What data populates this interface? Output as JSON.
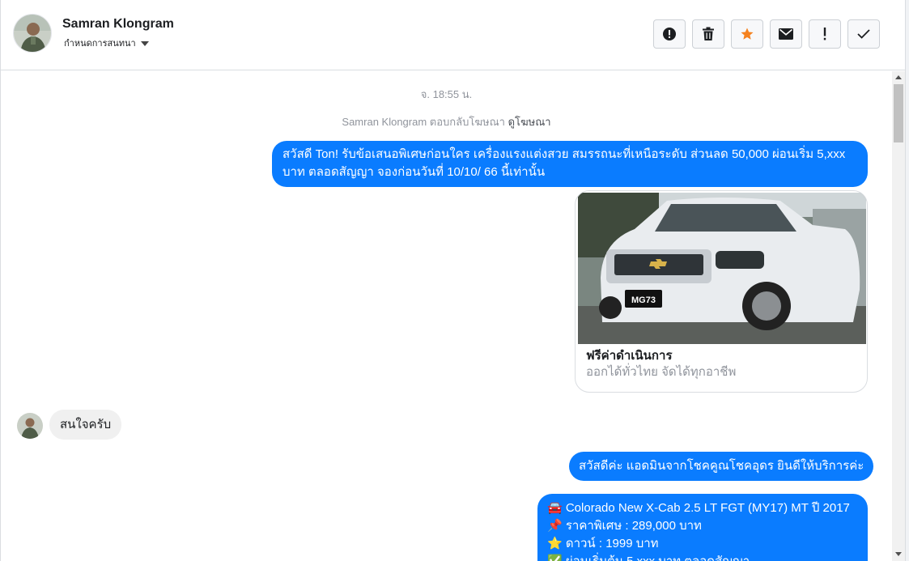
{
  "header": {
    "contact_name": "Samran Klongram",
    "subtitle": "กำหนดการสนทนา"
  },
  "toolbar": {
    "buttons": [
      {
        "icon": "alert-circle-icon"
      },
      {
        "icon": "trash-icon"
      },
      {
        "icon": "star-icon",
        "color": "#f5821f"
      },
      {
        "icon": "envelope-icon"
      },
      {
        "icon": "exclamation-icon"
      },
      {
        "icon": "check-icon"
      }
    ]
  },
  "thread": {
    "timestamp": "จ. 18:55 น.",
    "ad_reply_text": "Samran Klongram ตอบกลับโฆษณา",
    "ad_link": "ดูโฆษณา",
    "messages": [
      {
        "from": "page",
        "text": "สวัสดี Ton! รับข้อเสนอพิเศษก่อนใคร เครื่องแรงแต่งสวย สมรรถนะที่เหนือระดับ ส่วนลด 50,000 ผ่อนเริ่ม 5,xxx บาท ตลอดสัญญา จองก่อนวันที่ 10/10/ 66 นี้เท่านั้น"
      },
      {
        "from": "page",
        "card_title": "ฟรีค่าดำเนินการ",
        "card_subtitle": "ออกได้ทั่วไทย จัดได้ทุกอาชีพ",
        "plate": "MG73"
      },
      {
        "from": "user",
        "text": "สนใจครับ"
      },
      {
        "from": "page",
        "text": "สวัสดีค่ะ แอดมินจากโชคคูณโชคอุดร ยินดีให้บริการค่ะ"
      },
      {
        "from": "page",
        "lines": [
          "🚘 Colorado New X-Cab 2.5 LT FGT (MY17) MT ปี 2017",
          "📌 ราคาพิเศษ : 289,000 บาท",
          "⭐ ดาวน์ : 1999 บาท",
          "✅ ผ่อนเริ่มต้น 5,xxx บาท ตลอดสัญญา"
        ]
      }
    ]
  },
  "colors": {
    "outgoing_bubble": "#0a7cff",
    "incoming_bubble": "#f0f0f0",
    "star": "#f5821f"
  }
}
